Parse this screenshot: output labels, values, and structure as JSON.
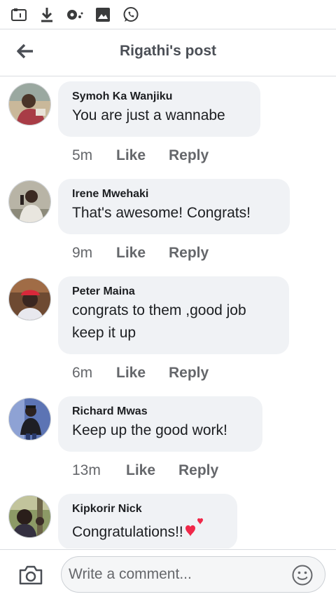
{
  "status_bar": {
    "icons": [
      "sd-card-icon",
      "download-icon",
      "vpn-key-icon",
      "image-icon",
      "whatsapp-icon"
    ]
  },
  "header": {
    "back_icon": "arrow-left-icon",
    "title": "Rigathi's post"
  },
  "comments": [
    {
      "author": "Symoh Ka Wanjiku",
      "lines": [
        "You are just a wannabe"
      ],
      "time": "5m",
      "like": "Like",
      "reply": "Reply"
    },
    {
      "author": "Irene Mwehaki",
      "lines": [
        "That's awesome! Congrats!"
      ],
      "time": "9m",
      "like": "Like",
      "reply": "Reply"
    },
    {
      "author": "Peter Maina",
      "lines": [
        "congrats to them ,good job",
        "keep it up"
      ],
      "time": "6m",
      "like": "Like",
      "reply": "Reply"
    },
    {
      "author": "Richard Mwas",
      "lines": [
        "Keep up the good work!"
      ],
      "time": "13m",
      "like": "Like",
      "reply": "Reply"
    },
    {
      "author": "Kipkorir Nick",
      "lines": [
        "Congratulations!!"
      ],
      "emoji": "hearts-icon"
    }
  ],
  "composer": {
    "camera_icon": "camera-icon",
    "placeholder": "Write a comment...",
    "emoji_icon": "smiley-icon"
  },
  "colors": {
    "bubble": "#f0f2f5",
    "meta_text": "#65676b",
    "title_text": "#4b4f56",
    "heart": "#f02849",
    "whatsapp": "#0a8a56"
  }
}
